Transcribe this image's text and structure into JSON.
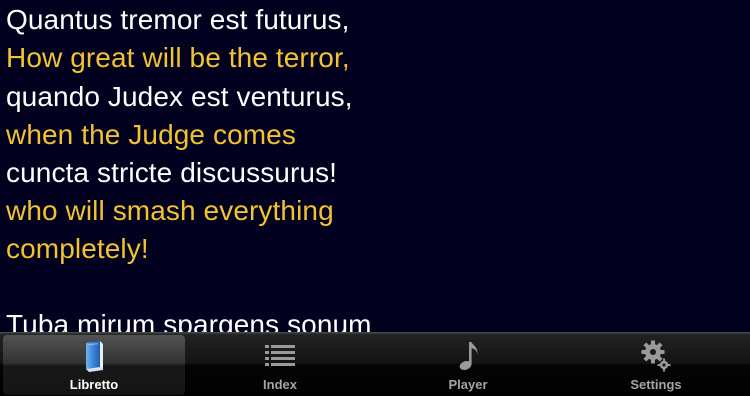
{
  "libretto": {
    "lines": [
      {
        "text": "Quantus tremor est futurus,",
        "lang": "latin"
      },
      {
        "text": "How great will be the terror,",
        "lang": "english"
      },
      {
        "text": "quando Judex est venturus,",
        "lang": "latin"
      },
      {
        "text": "when the Judge comes",
        "lang": "english"
      },
      {
        "text": "cuncta stricte discussurus!",
        "lang": "latin"
      },
      {
        "text": "who will smash everything",
        "lang": "english"
      },
      {
        "text": "completely!",
        "lang": "english"
      },
      {
        "text": "",
        "lang": "latin"
      },
      {
        "text": "Tuba mirum spargens sonum",
        "lang": "latin"
      }
    ],
    "colors": {
      "latin": "#ffffff",
      "english": "#f1c232",
      "background": "#01001f"
    }
  },
  "tabbar": {
    "tabs": [
      {
        "label": "Libretto",
        "icon": "book-icon",
        "selected": true
      },
      {
        "label": "Index",
        "icon": "list-icon",
        "selected": false
      },
      {
        "label": "Player",
        "icon": "music-note-icon",
        "selected": false
      },
      {
        "label": "Settings",
        "icon": "gears-icon",
        "selected": false
      }
    ]
  }
}
